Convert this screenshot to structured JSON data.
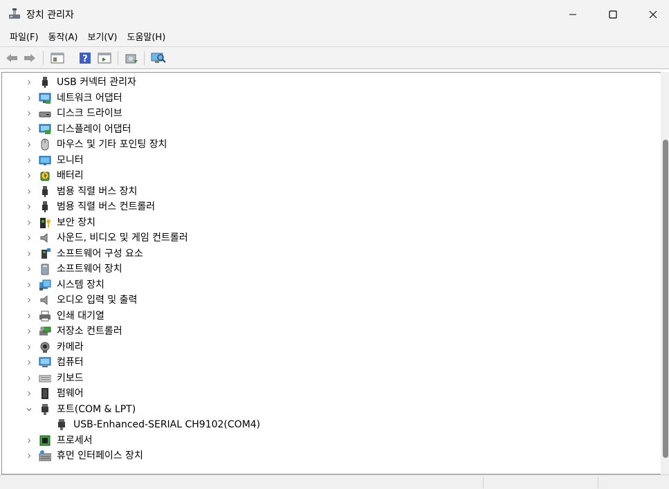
{
  "window": {
    "title": "장치 관리자"
  },
  "menubar": {
    "items": [
      "파일(F)",
      "동작(A)",
      "보기(V)",
      "도움말(H)"
    ]
  },
  "toolbar": {
    "buttons": [
      "back-icon",
      "forward-icon",
      "properties-icon",
      "help-icon",
      "view-icon",
      "update-driver-icon",
      "scan-hardware-icon"
    ]
  },
  "tree": {
    "items": [
      {
        "label": "USB 커넥터 관리자",
        "icon": "usb-connector-icon",
        "expanded": false
      },
      {
        "label": "네트워크 어댑터",
        "icon": "network-adapter-icon",
        "expanded": false
      },
      {
        "label": "디스크 드라이브",
        "icon": "disk-drive-icon",
        "expanded": false
      },
      {
        "label": "디스플레이 어댑터",
        "icon": "display-adapter-icon",
        "expanded": false
      },
      {
        "label": "마우스 및 기타 포인팅 장치",
        "icon": "mouse-icon",
        "expanded": false
      },
      {
        "label": "모니터",
        "icon": "monitor-icon",
        "expanded": false
      },
      {
        "label": "배터리",
        "icon": "battery-icon",
        "expanded": false
      },
      {
        "label": "범용 직렬 버스 장치",
        "icon": "usb-device-icon",
        "expanded": false
      },
      {
        "label": "범용 직렬 버스 컨트롤러",
        "icon": "usb-controller-icon",
        "expanded": false
      },
      {
        "label": "보안 장치",
        "icon": "security-device-icon",
        "expanded": false
      },
      {
        "label": "사운드, 비디오 및 게임 컨트롤러",
        "icon": "sound-icon",
        "expanded": false
      },
      {
        "label": "소프트웨어 구성 요소",
        "icon": "software-component-icon",
        "expanded": false
      },
      {
        "label": "소프트웨어 장치",
        "icon": "software-device-icon",
        "expanded": false
      },
      {
        "label": "시스템 장치",
        "icon": "system-device-icon",
        "expanded": false
      },
      {
        "label": "오디오 입력 및 출력",
        "icon": "audio-io-icon",
        "expanded": false
      },
      {
        "label": "인쇄 대기열",
        "icon": "print-queue-icon",
        "expanded": false
      },
      {
        "label": "저장소 컨트롤러",
        "icon": "storage-controller-icon",
        "expanded": false
      },
      {
        "label": "카메라",
        "icon": "camera-icon",
        "expanded": false
      },
      {
        "label": "컴퓨터",
        "icon": "computer-icon",
        "expanded": false
      },
      {
        "label": "키보드",
        "icon": "keyboard-icon",
        "expanded": false
      },
      {
        "label": "펌웨어",
        "icon": "firmware-icon",
        "expanded": false
      },
      {
        "label": "포트(COM & LPT)",
        "icon": "port-icon",
        "expanded": true
      },
      {
        "label": "USB-Enhanced-SERIAL CH9102(COM4)",
        "icon": "port-icon",
        "child": true
      },
      {
        "label": "프로세서",
        "icon": "processor-icon",
        "expanded": false
      },
      {
        "label": "휴먼 인터페이스 장치",
        "icon": "hid-icon",
        "expanded": false
      }
    ]
  }
}
